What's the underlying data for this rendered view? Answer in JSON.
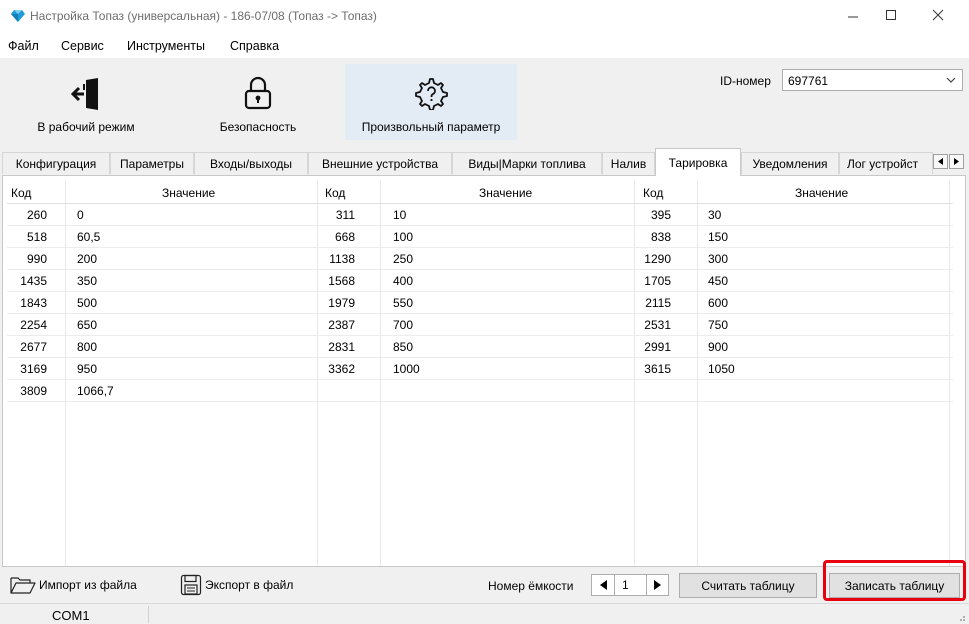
{
  "window": {
    "title": "Настройка Топаз (универсальная) - 186-07/08 (Топаз -> Топаз)",
    "accent_color": "#1f9bd7"
  },
  "menu": [
    "Файл",
    "Сервис",
    "Инструменты",
    "Справка"
  ],
  "toolbar": {
    "work_mode": "В рабочий режим",
    "security": "Безопасность",
    "custom_param": "Произвольный параметр",
    "id_label": "ID-номер",
    "id_value": "697761"
  },
  "tabs": [
    "Конфигурация",
    "Параметры",
    "Входы/выходы",
    "Внешние устройства",
    "Виды|Марки топлива",
    "Налив",
    "Тарировка",
    "Уведомления",
    "Лог устройст"
  ],
  "active_tab": "Тарировка",
  "table": {
    "headers": [
      "Код",
      "Значение",
      "Код",
      "Значение",
      "Код",
      "Значение"
    ],
    "rows": [
      [
        "260",
        "0",
        "311",
        "10",
        "395",
        "30"
      ],
      [
        "518",
        "60,5",
        "668",
        "100",
        "838",
        "150"
      ],
      [
        "990",
        "200",
        "1138",
        "250",
        "1290",
        "300"
      ],
      [
        "1435",
        "350",
        "1568",
        "400",
        "1705",
        "450"
      ],
      [
        "1843",
        "500",
        "1979",
        "550",
        "2115",
        "600"
      ],
      [
        "2254",
        "650",
        "2387",
        "700",
        "2531",
        "750"
      ],
      [
        "2677",
        "800",
        "2831",
        "850",
        "2991",
        "900"
      ],
      [
        "3169",
        "950",
        "3362",
        "1000",
        "3615",
        "1050"
      ],
      [
        "3809",
        "1066,7",
        "",
        "",
        "",
        ""
      ]
    ]
  },
  "bottom": {
    "import": "Импорт из файла",
    "export": "Экспорт в файл",
    "capacity_label": "Номер ёмкости",
    "capacity_value": "1",
    "read_table": "Считать таблицу",
    "write_table": "Записать таблицу",
    "highlight_color": "#e8000e"
  },
  "status": {
    "port": "COM1"
  }
}
